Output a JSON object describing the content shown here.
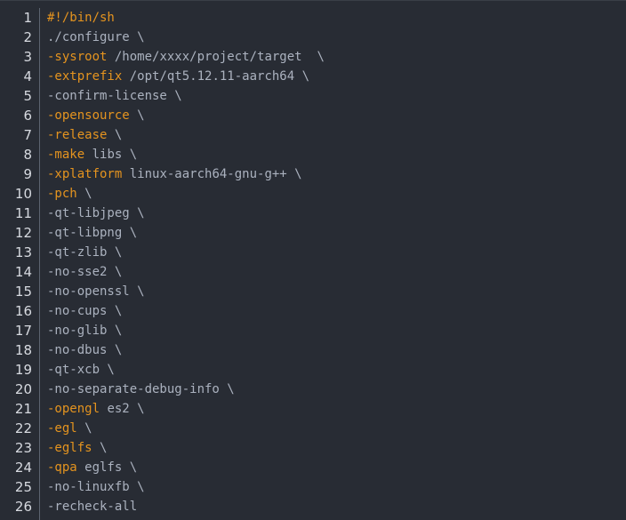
{
  "editor": {
    "lines": [
      {
        "num": "1",
        "flag": "#!/bin/sh",
        "rest": ""
      },
      {
        "num": "2",
        "flag": "",
        "rest": "./configure \\"
      },
      {
        "num": "3",
        "flag": "-sysroot",
        "rest": " /home/xxxx/project/target  \\"
      },
      {
        "num": "4",
        "flag": "-extprefix",
        "rest": " /opt/qt5.12.11-aarch64 \\"
      },
      {
        "num": "5",
        "flag": "",
        "rest": "-confirm-license \\"
      },
      {
        "num": "6",
        "flag": "-opensource",
        "rest": " \\"
      },
      {
        "num": "7",
        "flag": "-release",
        "rest": " \\"
      },
      {
        "num": "8",
        "flag": "-make",
        "rest": " libs \\"
      },
      {
        "num": "9",
        "flag": "-xplatform",
        "rest": " linux-aarch64-gnu-g++ \\"
      },
      {
        "num": "10",
        "flag": "-pch",
        "rest": " \\"
      },
      {
        "num": "11",
        "flag": "",
        "rest": "-qt-libjpeg \\"
      },
      {
        "num": "12",
        "flag": "",
        "rest": "-qt-libpng \\"
      },
      {
        "num": "13",
        "flag": "",
        "rest": "-qt-zlib \\"
      },
      {
        "num": "14",
        "flag": "",
        "rest": "-no-sse2 \\"
      },
      {
        "num": "15",
        "flag": "",
        "rest": "-no-openssl \\"
      },
      {
        "num": "16",
        "flag": "",
        "rest": "-no-cups \\"
      },
      {
        "num": "17",
        "flag": "",
        "rest": "-no-glib \\"
      },
      {
        "num": "18",
        "flag": "",
        "rest": "-no-dbus \\"
      },
      {
        "num": "19",
        "flag": "",
        "rest": "-qt-xcb \\"
      },
      {
        "num": "20",
        "flag": "",
        "rest": "-no-separate-debug-info \\"
      },
      {
        "num": "21",
        "flag": "-opengl",
        "rest": " es2 \\"
      },
      {
        "num": "22",
        "flag": "-egl",
        "rest": " \\"
      },
      {
        "num": "23",
        "flag": "-eglfs",
        "rest": " \\"
      },
      {
        "num": "24",
        "flag": "-qpa",
        "rest": " eglfs \\"
      },
      {
        "num": "25",
        "flag": "",
        "rest": "-no-linuxfb \\"
      },
      {
        "num": "26",
        "flag": "",
        "rest": "-recheck-all"
      }
    ],
    "colors": {
      "background": "#282c34",
      "keyword": "#e5941f",
      "text": "#abb2bf",
      "line_number": "#d7dae0"
    }
  }
}
